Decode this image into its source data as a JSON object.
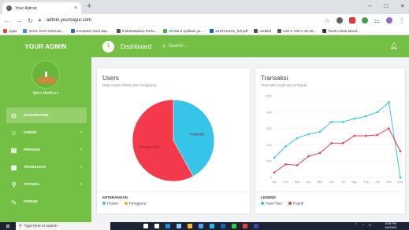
{
  "browser": {
    "tab_title": "Your Admin",
    "tab_close": "×",
    "new_tab": "+",
    "url": "admin.yoursayur.com",
    "win_min": "–",
    "win_max": "□",
    "win_close": "×",
    "bookmarks": [
      {
        "label": "Apps",
        "color": "#e8453c"
      },
      {
        "label": "SOAL DAN SOLUSI...",
        "color": "#4a90d9"
      },
      {
        "label": "Komputer Soal dan...",
        "color": "#2c6fb8"
      },
      {
        "label": "5 Marketplace Perla...",
        "color": "#555555"
      },
      {
        "label": "Ini Dia 5 Aplikasi ya...",
        "color": "#4caf50"
      },
      {
        "label": "1413741101_full.pdf",
        "color": "#1565c0"
      },
      {
        "label": "untitled",
        "color": "#555555"
      },
      {
        "label": "210-1-700-1-10-20...",
        "color": "#555555"
      },
      {
        "label": "Tools Untuk Mend...",
        "color": "#333333"
      }
    ]
  },
  "sidebar": {
    "brand": "YOUR ADMIN",
    "user_name": "Ighra Medina ▾",
    "items": [
      {
        "label": "DASHBOARD",
        "icon": "⊙",
        "active": true,
        "arrow": ""
      },
      {
        "label": "USERS",
        "icon": "☺",
        "active": false,
        "arrow": "‹"
      },
      {
        "label": "PRODUK",
        "icon": "▤",
        "active": false,
        "arrow": "‹"
      },
      {
        "label": "TRANSAKSI",
        "icon": "▦",
        "active": false,
        "arrow": "‹"
      },
      {
        "label": "ARTIKEL",
        "icon": "⚲",
        "active": false,
        "arrow": "‹"
      },
      {
        "label": "FORUM",
        "icon": "∿",
        "active": false,
        "arrow": ""
      }
    ]
  },
  "topbar": {
    "title": "Dashboard",
    "search_placeholder": "Search...",
    "icon_letter": "1"
  },
  "users_card": {
    "title": "Users",
    "subtitle": "Data Users Petani dan Pengguna",
    "legend_title": "KETERANGAN",
    "legend": [
      {
        "label": "Petani",
        "color": "#36c5e8"
      },
      {
        "label": "Pengguna",
        "color": "#f5a623"
      }
    ]
  },
  "transaksi_card": {
    "title": "Transaksi",
    "subtitle": "Transaksi Hasil tani & Pupuk",
    "legend_title": "LEGEND",
    "legend": [
      {
        "label": "Hasil Tani",
        "color": "#36c5e8"
      },
      {
        "label": "Pupuk",
        "color": "#f43a4a"
      }
    ]
  },
  "chart_data": [
    {
      "type": "pie",
      "title": "Users",
      "categories": [
        "Petani",
        "Pengguna"
      ],
      "values": [
        42,
        58
      ],
      "colors": [
        "#36c5e8",
        "#f43a4a"
      ],
      "slice_labels": [
        "Petani(0)",
        "Pengguna(1)"
      ]
    },
    {
      "type": "line",
      "title": "Transaksi",
      "categories": [
        "Jan",
        "Feb",
        "Mar",
        "Apr",
        "Mei",
        "Jun",
        "Jul",
        "Agu",
        "Sep",
        "Okt",
        "Nov",
        "Des"
      ],
      "ylim": [
        0,
        1000
      ],
      "yticks": [
        0,
        200,
        400,
        600,
        800,
        1000
      ],
      "grid": true,
      "series": [
        {
          "name": "Hasil Tani",
          "color": "#36c5e8",
          "values": [
            240,
            380,
            480,
            530,
            560,
            680,
            680,
            720,
            750,
            800,
            920,
            0
          ]
        },
        {
          "name": "Pupuk",
          "color": "#f43a4a",
          "values": [
            60,
            160,
            150,
            260,
            300,
            420,
            420,
            510,
            510,
            520,
            600,
            320
          ]
        }
      ]
    }
  ],
  "taskbar": {
    "search": "Type here to search",
    "time": "8:05 PM",
    "date": "4/6/2020",
    "icons": [
      {
        "name": "cortana",
        "color": "#ffffff"
      },
      {
        "name": "task-view",
        "color": "#ffffff"
      },
      {
        "name": "edge",
        "color": "#1e88e5"
      },
      {
        "name": "store",
        "color": "#90caf9"
      },
      {
        "name": "explorer",
        "color": "#fbc02d"
      },
      {
        "name": "mail",
        "color": "#42a5f5"
      },
      {
        "name": "photos",
        "color": "#29b6f6"
      },
      {
        "name": "word",
        "color": "#1565c0"
      },
      {
        "name": "spotify",
        "color": "#2ecc40"
      },
      {
        "name": "chrome",
        "color": "#ea4335"
      },
      {
        "name": "app",
        "color": "#3949ab"
      }
    ]
  }
}
